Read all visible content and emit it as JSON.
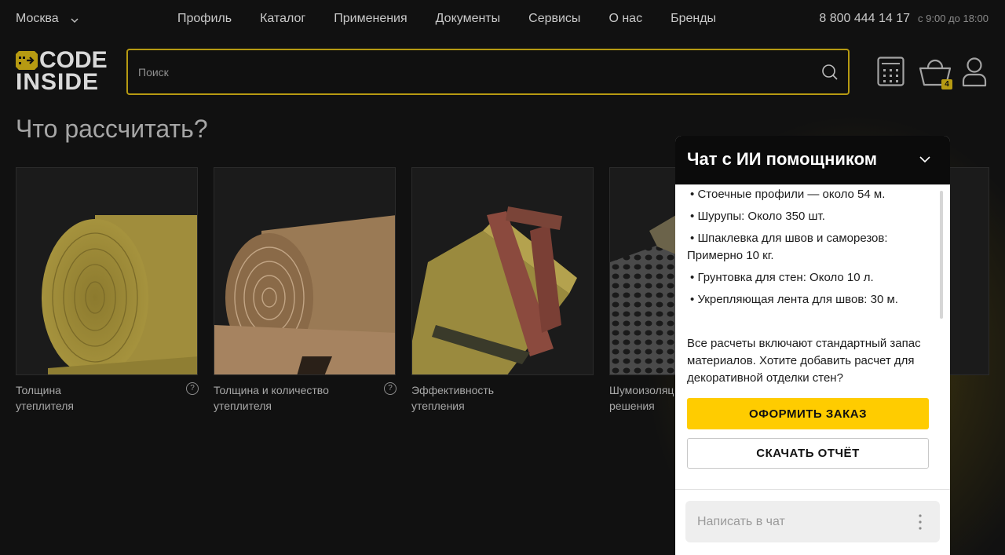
{
  "topbar": {
    "city": "Москва",
    "nav": [
      "Профиль",
      "Каталог",
      "Применения",
      "Документы",
      "Сервисы",
      "О нас",
      "Бренды"
    ],
    "phone": "8 800 444 14 17",
    "hours": "с 9:00 до 18:00"
  },
  "logo": {
    "line1": "CODE",
    "line2": "INSIDE"
  },
  "search": {
    "placeholder": "Поиск"
  },
  "header": {
    "cart_count": "4"
  },
  "main": {
    "heading": "Что рассчитать?",
    "cards": [
      {
        "label": "Толщина утеплителя",
        "help": "?"
      },
      {
        "label": "Толщина и количество утеплителя",
        "help": "?"
      },
      {
        "label": "Эффективность утепления"
      },
      {
        "label": "Шумоизоляц решения"
      }
    ]
  },
  "chat": {
    "title": "Чат с ИИ помощником",
    "items": [
      "Стоечные профили — около 54 м.",
      "Шурупы: Около 350 шт.",
      "Шпаклевка для швов и саморезов: Примерно 10 кг.",
      "Грунтовка для стен: Около 10 л.",
      "Укрепляющая лента для швов: 30 м."
    ],
    "bullet": "•",
    "summary": "Все расчеты включают стандартный запас материалов. Хотите добавить расчет для декоративной отделки стен?",
    "order_button": "ОФОРМИТЬ ЗАКАЗ",
    "report_button": "СКАЧАТЬ ОТЧЁТ",
    "input_placeholder": "Написать в чат"
  },
  "colors": {
    "accent": "#ffcc00",
    "accent_dim": "#b69a12",
    "background": "#111111"
  }
}
